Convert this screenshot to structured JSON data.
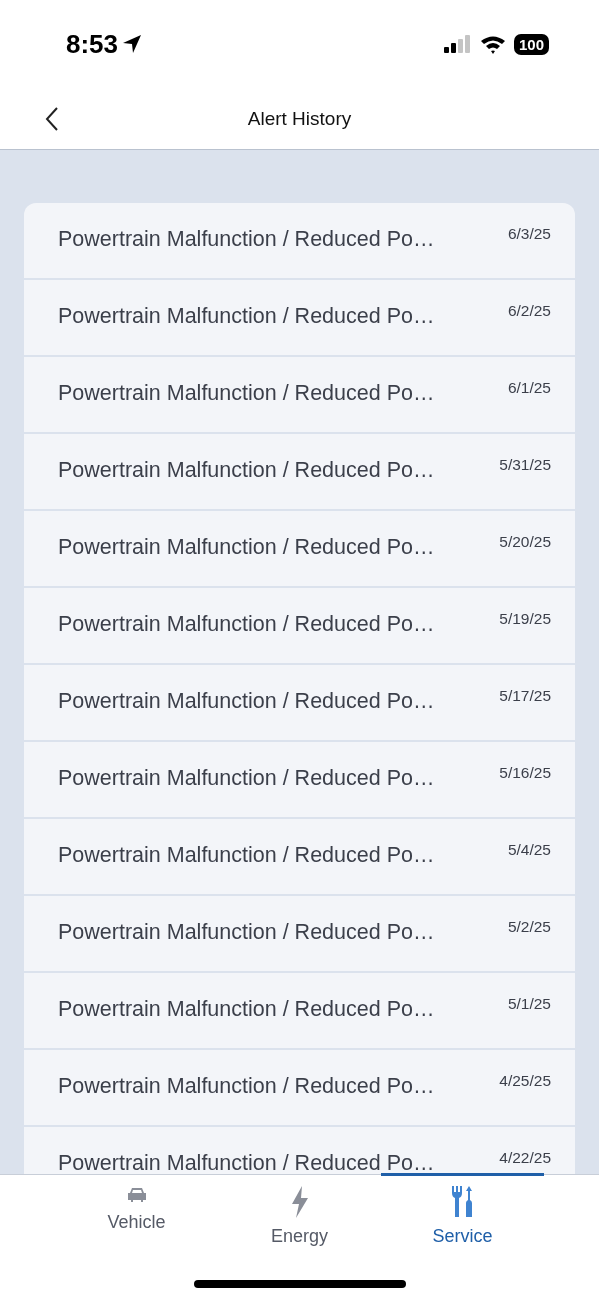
{
  "status_bar": {
    "time": "8:53",
    "battery": "100"
  },
  "header": {
    "title": "Alert History"
  },
  "alerts": [
    {
      "title": "Powertrain Malfunction / Reduced Po…",
      "date": "6/3/25"
    },
    {
      "title": "Powertrain Malfunction / Reduced Po…",
      "date": "6/2/25"
    },
    {
      "title": "Powertrain Malfunction / Reduced Po…",
      "date": "6/1/25"
    },
    {
      "title": "Powertrain Malfunction / Reduced Po…",
      "date": "5/31/25"
    },
    {
      "title": "Powertrain Malfunction / Reduced Po…",
      "date": "5/20/25"
    },
    {
      "title": "Powertrain Malfunction / Reduced Po…",
      "date": "5/19/25"
    },
    {
      "title": "Powertrain Malfunction / Reduced Po…",
      "date": "5/17/25"
    },
    {
      "title": "Powertrain Malfunction / Reduced Po…",
      "date": "5/16/25"
    },
    {
      "title": "Powertrain Malfunction / Reduced Po…",
      "date": "5/4/25"
    },
    {
      "title": "Powertrain Malfunction / Reduced Po…",
      "date": "5/2/25"
    },
    {
      "title": "Powertrain Malfunction / Reduced Po…",
      "date": "5/1/25"
    },
    {
      "title": "Powertrain Malfunction / Reduced Po…",
      "date": "4/25/25"
    },
    {
      "title": "Powertrain Malfunction / Reduced Po…",
      "date": "4/22/25"
    }
  ],
  "tabs": [
    {
      "label": "Vehicle",
      "kind": "car",
      "selected": false
    },
    {
      "label": "Energy",
      "kind": "bolt",
      "selected": false
    },
    {
      "label": "Service",
      "kind": "tools",
      "selected": true
    }
  ]
}
